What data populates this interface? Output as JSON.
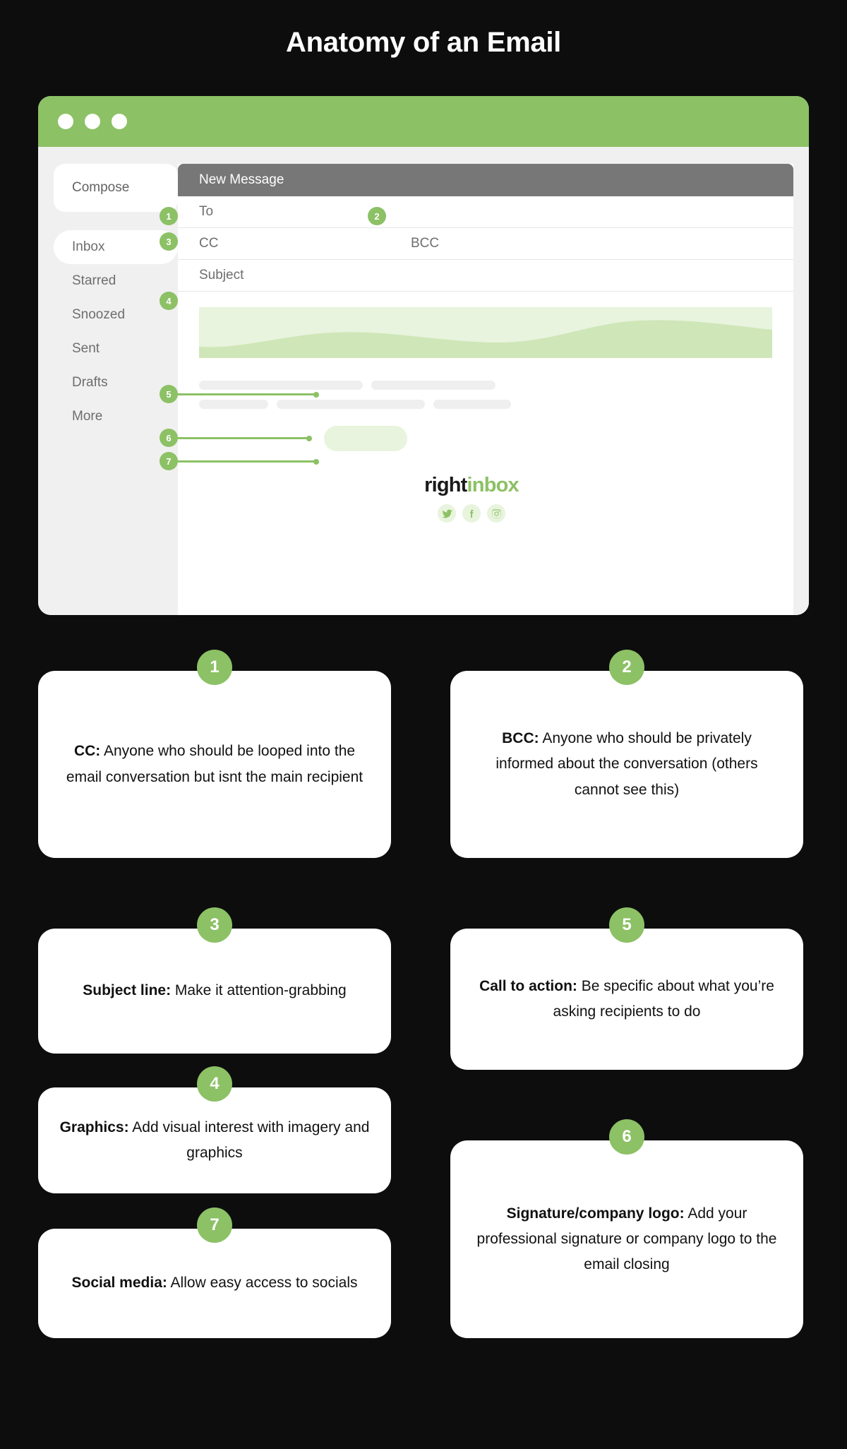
{
  "title": "Anatomy of an Email",
  "colors": {
    "background": "#0d0d0d",
    "accent_green": "#8cc165",
    "light_green": "#e8f4dd",
    "panel_gray": "#f0f0f0",
    "header_gray": "#777777",
    "card_white": "#ffffff"
  },
  "browser": {
    "window_dots": 3,
    "sidebar": {
      "compose_label": "Compose",
      "items": [
        {
          "label": "Inbox",
          "active": true
        },
        {
          "label": "Starred",
          "active": false
        },
        {
          "label": "Snoozed",
          "active": false
        },
        {
          "label": "Sent",
          "active": false
        },
        {
          "label": "Drafts",
          "active": false
        },
        {
          "label": "More",
          "active": false
        }
      ]
    },
    "compose_panel": {
      "header": "New Message",
      "fields": [
        {
          "label": "To",
          "badge": null
        },
        {
          "label": "CC",
          "badge": "1"
        },
        {
          "label": "BCC",
          "badge": "2"
        },
        {
          "label": "Subject",
          "badge": "3"
        }
      ],
      "graphic_badge": "4",
      "cta_badge": "5",
      "signature_badge": "6",
      "social_badge": "7",
      "logo": {
        "part1": "right",
        "part2": "inbox"
      },
      "social_icons": [
        {
          "name": "twitter-icon",
          "label": "Twitter"
        },
        {
          "name": "facebook-icon",
          "label": "Facebook"
        },
        {
          "name": "instagram-icon",
          "label": "Instagram"
        }
      ]
    }
  },
  "cards": [
    {
      "number": "1",
      "bold": "CC:",
      "text": " Anyone who should be looped into the email conversation but isnt the main recipient"
    },
    {
      "number": "2",
      "bold": "BCC:",
      "text": " Anyone who should be privately informed about the conversation (others cannot see this)"
    },
    {
      "number": "3",
      "bold": "Subject line:",
      "text": " Make it attention-grabbing"
    },
    {
      "number": "5",
      "bold": "Call to action:",
      "text": " Be specific about what you’re asking recipients to do"
    },
    {
      "number": "4",
      "bold": "Graphics:",
      "text": " Add visual interest with imagery and graphics"
    },
    {
      "number": "6",
      "bold": "Signature/company logo:",
      "text": " Add your professional signature or company logo to the email closing"
    },
    {
      "number": "7",
      "bold": "Social media:",
      "text": " Allow easy access to socials"
    }
  ]
}
